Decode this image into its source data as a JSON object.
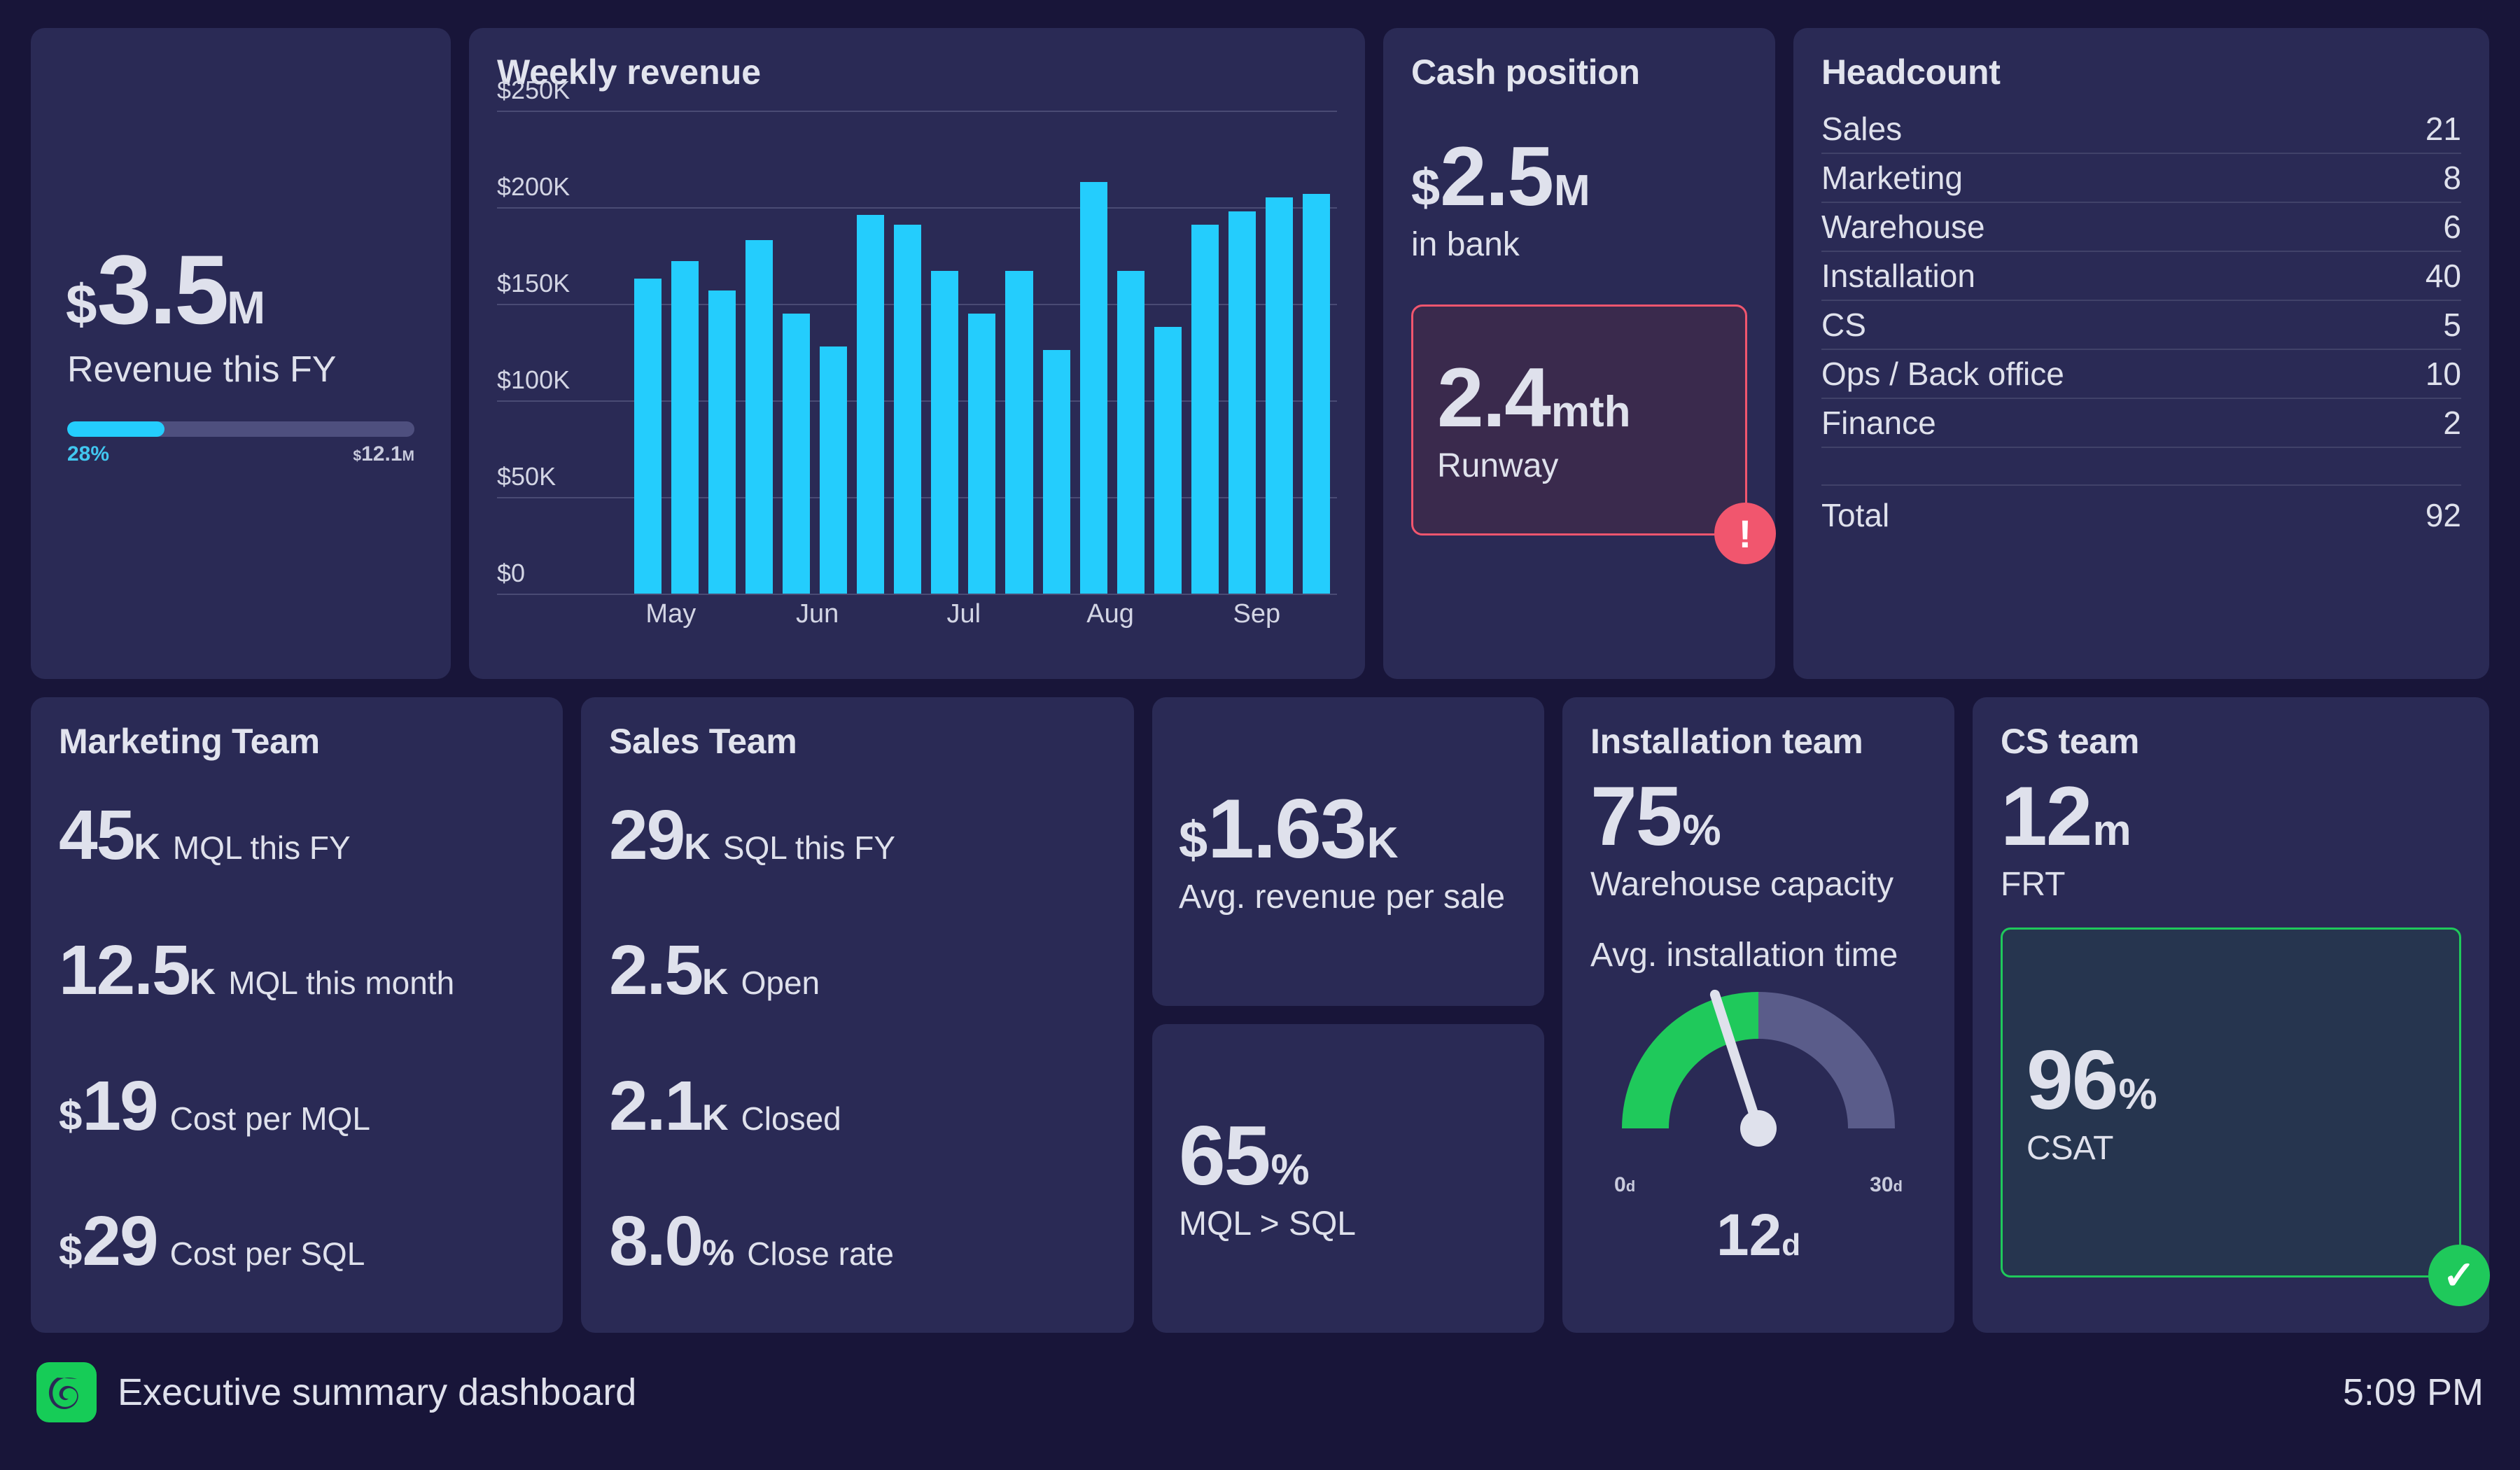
{
  "revenue_card": {
    "currency": "$",
    "value": "3.5",
    "unit": "M",
    "label": "Revenue this FY",
    "progress_pct_text": "28%",
    "progress_pct": 28,
    "goal_value": "12.1",
    "goal_currency": "$",
    "goal_unit": "M",
    "accent_color": "#24cdfd"
  },
  "chart_data": {
    "type": "bar",
    "title": "Weekly revenue",
    "xlabel": "",
    "ylabel": "",
    "ylim": [
      0,
      250
    ],
    "y_ticks": [
      0,
      50,
      100,
      150,
      200,
      250
    ],
    "y_tick_labels": [
      "$0",
      "$50K",
      "$100K",
      "$150K",
      "$200K",
      "$250K"
    ],
    "grid": true,
    "legend": "none",
    "bar_color": "#24cdfd",
    "units": "thousands of dollars",
    "categories": [
      "May",
      "Jun",
      "Jul",
      "Aug",
      "Sep"
    ],
    "x_tick_labels": [
      "May",
      "Jun",
      "Jul",
      "Aug",
      "Sep"
    ],
    "values": [
      163,
      172,
      157,
      183,
      145,
      128,
      196,
      191,
      167,
      145,
      167,
      126,
      213,
      167,
      138,
      191,
      198,
      205,
      207
    ]
  },
  "cash_card": {
    "title": "Cash position",
    "currency": "$",
    "value": "2.5",
    "unit": "M",
    "label": "in bank",
    "runway_value": "2.4",
    "runway_unit": "mth",
    "runway_label": "Runway",
    "alert_icon": "!",
    "alert_color": "#f1566e"
  },
  "headcount_card": {
    "title": "Headcount",
    "rows": [
      {
        "label": "Sales",
        "value": "21"
      },
      {
        "label": "Marketing",
        "value": "8"
      },
      {
        "label": "Warehouse",
        "value": "6"
      },
      {
        "label": "Installation",
        "value": "40"
      },
      {
        "label": "CS",
        "value": "5"
      },
      {
        "label": "Ops / Back office",
        "value": "10"
      },
      {
        "label": "Finance",
        "value": "2"
      }
    ],
    "total_label": "Total",
    "total_value": "92"
  },
  "marketing_card": {
    "title": "Marketing Team",
    "metrics": [
      {
        "currency": "",
        "value": "45",
        "unit": "K",
        "label": "MQL this FY"
      },
      {
        "currency": "",
        "value": "12.5",
        "unit": "K",
        "label": "MQL this month"
      },
      {
        "currency": "$",
        "value": "19",
        "unit": "",
        "label": "Cost per MQL"
      },
      {
        "currency": "$",
        "value": "29",
        "unit": "",
        "label": "Cost per SQL"
      }
    ]
  },
  "sales_card": {
    "title": "Sales Team",
    "metrics": [
      {
        "currency": "",
        "value": "29",
        "unit": "K",
        "label": "SQL this FY"
      },
      {
        "currency": "",
        "value": "2.5",
        "unit": "K",
        "label": "Open"
      },
      {
        "currency": "",
        "value": "2.1",
        "unit": "K",
        "label": "Closed"
      },
      {
        "currency": "",
        "value": "8.0",
        "unit": "%",
        "label": "Close rate"
      }
    ]
  },
  "avg_revenue_card": {
    "currency": "$",
    "value": "1.63",
    "unit": "K",
    "label": "Avg. revenue per sale"
  },
  "mql_sql_card": {
    "currency": "",
    "value": "65",
    "unit": "%",
    "label": "MQL > SQL"
  },
  "installation_card": {
    "title": "Installation team",
    "capacity_value": "75",
    "capacity_unit": "%",
    "capacity_label": "Warehouse capacity",
    "gauge_title": "Avg. installation time",
    "gauge_min_label": "0",
    "gauge_min_unit": "d",
    "gauge_max_label": "30",
    "gauge_max_unit": "d",
    "gauge_value": "12",
    "gauge_value_unit": "d",
    "gauge_min": 0,
    "gauge_max": 30,
    "gauge_current": 12,
    "gauge_green_end": 15,
    "gauge_green_color": "#1fc95b",
    "gauge_track_color": "#5a5c8a"
  },
  "cs_card": {
    "title": "CS team",
    "frt_value": "12",
    "frt_unit": "m",
    "frt_label": "FRT",
    "csat_value": "96",
    "csat_unit": "%",
    "csat_label": "CSAT",
    "ok_icon": "✓",
    "ok_color": "#1fc95b"
  },
  "footer": {
    "title": "Executive summary dashboard",
    "time": "5:09 PM",
    "logo_color": "#16cc57"
  }
}
